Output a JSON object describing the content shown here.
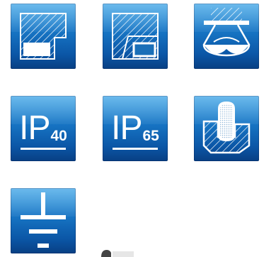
{
  "icons": [
    {
      "name": "surface-mount-corner-icon"
    },
    {
      "name": "surface-mount-edge-icon"
    },
    {
      "name": "ceiling-light-beam-icon"
    },
    {
      "name": "ip40-rating-icon",
      "prefix": "IP",
      "rating": "40"
    },
    {
      "name": "ip65-rating-icon",
      "prefix": "IP",
      "rating": "65"
    },
    {
      "name": "recessed-mount-hand-icon"
    },
    {
      "name": "earth-ground-class-icon"
    }
  ],
  "colors": {
    "tile_top": "#33a0e6",
    "tile_bottom": "#083f83",
    "glyph": "#ffffff"
  }
}
